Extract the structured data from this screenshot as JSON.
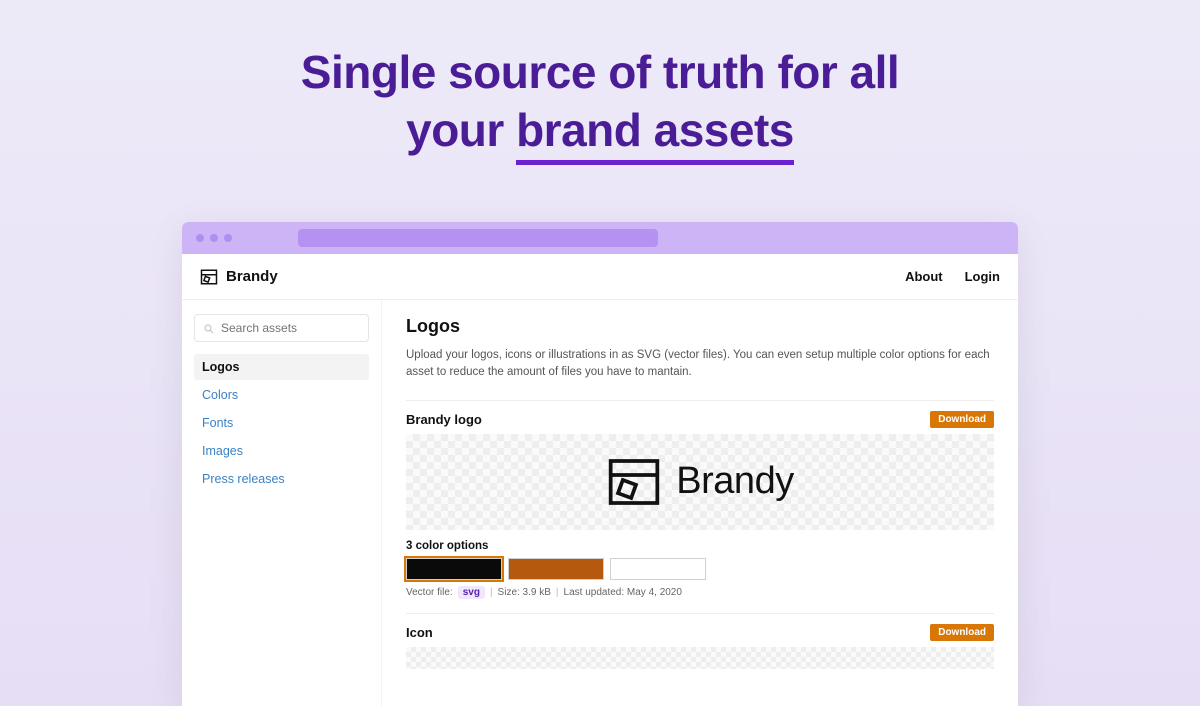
{
  "hero": {
    "line1": "Single source of truth for all",
    "line2_pre": "your ",
    "line2_underlined": "brand assets"
  },
  "header": {
    "brand": "Brandy",
    "links": {
      "about": "About",
      "login": "Login"
    }
  },
  "sidebar": {
    "search_placeholder": "Search assets",
    "items": [
      {
        "label": "Logos",
        "active": true
      },
      {
        "label": "Colors"
      },
      {
        "label": "Fonts"
      },
      {
        "label": "Images"
      },
      {
        "label": "Press releases"
      }
    ]
  },
  "main": {
    "title": "Logos",
    "description": "Upload your logos, icons or illustrations in as SVG (vector files). You can even setup multiple color options for each asset to reduce the amount of files you have to mantain.",
    "download_label": "Download",
    "assets": [
      {
        "title": "Brandy logo",
        "preview_text": "Brandy",
        "options_label": "3 color options",
        "swatches": [
          "black",
          "orange",
          "white"
        ],
        "selected_swatch": "black",
        "meta": {
          "file_label": "Vector file:",
          "file_type": "svg",
          "size_label": "Size: 3.9 kB",
          "updated_label": "Last updated: May 4, 2020"
        }
      },
      {
        "title": "Icon"
      }
    ]
  }
}
